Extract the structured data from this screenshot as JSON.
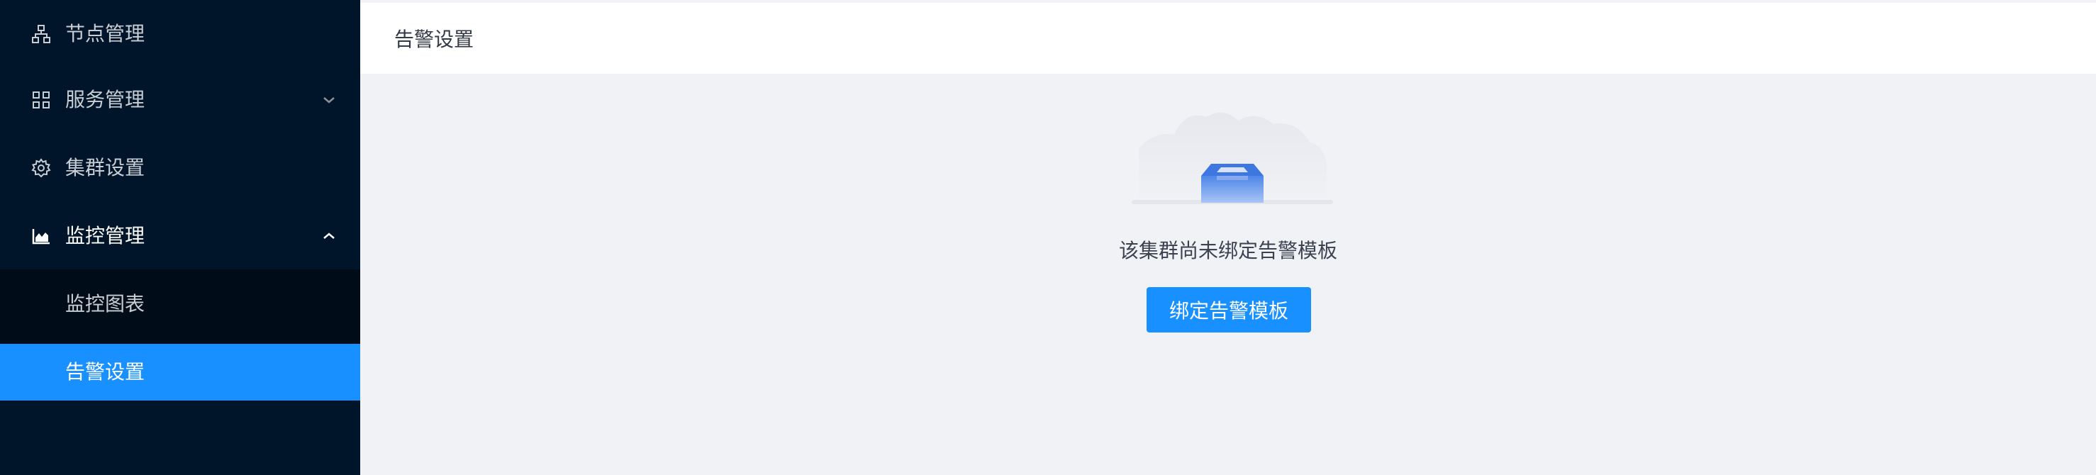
{
  "sidebar": {
    "items": [
      {
        "label": "节点管理",
        "icon": "node-tree-icon"
      },
      {
        "label": "服务管理",
        "icon": "grid-apps-icon",
        "arrow": "chevron-down-icon"
      },
      {
        "label": "集群设置",
        "icon": "gear-icon"
      },
      {
        "label": "监控管理",
        "icon": "area-chart-icon",
        "arrow": "chevron-up-icon"
      }
    ],
    "submenu": [
      {
        "label": "监控图表"
      },
      {
        "label": "告警设置",
        "active": true
      }
    ]
  },
  "header": {
    "title": "告警设置"
  },
  "empty": {
    "icon": "empty-inbox-icon",
    "text": "该集群尚未绑定告警模板",
    "button_label": "绑定告警模板"
  },
  "colors": {
    "sidebar_bg": "#001529",
    "submenu_bg": "#000c17",
    "accent": "#1890ff",
    "content_bg": "#f0f2f5"
  }
}
